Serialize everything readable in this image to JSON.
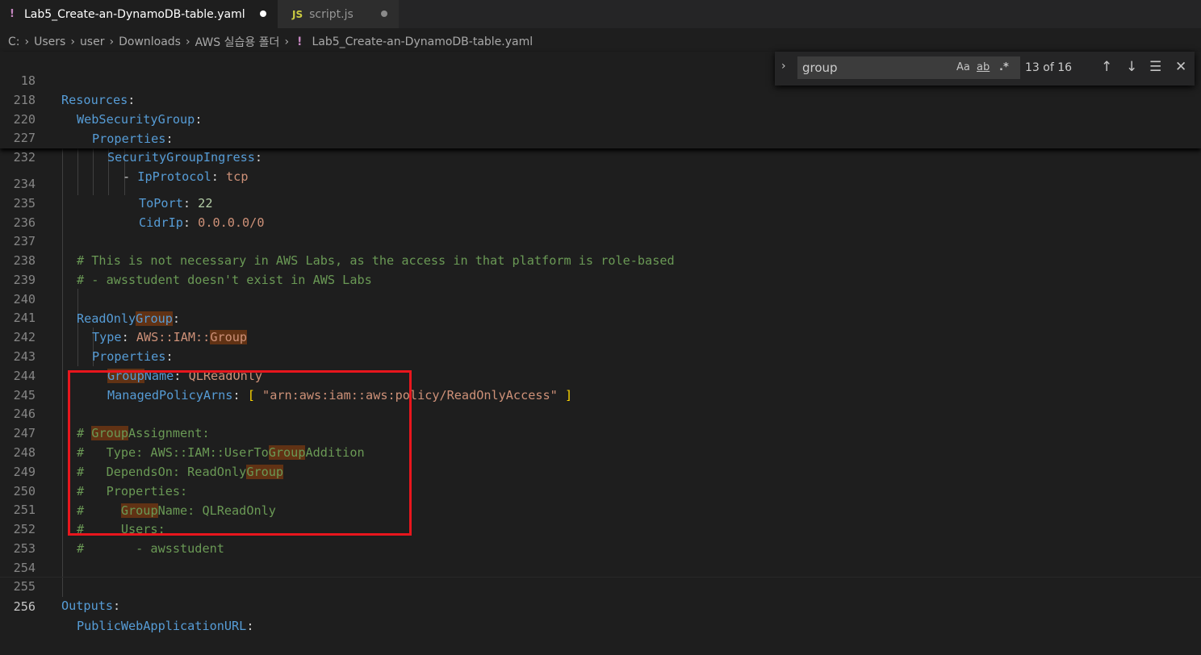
{
  "tabs": [
    {
      "label": "Lab5_Create-an-DynamoDB-table.yaml",
      "icon": "!",
      "active": true
    },
    {
      "label": "script.js",
      "icon": "JS",
      "active": false
    }
  ],
  "breadcrumb": {
    "parts": [
      "C:",
      "Users",
      "user",
      "Downloads",
      "AWS 실습용 폴더"
    ],
    "file_icon": "!",
    "file": "Lab5_Create-an-DynamoDB-table.yaml"
  },
  "find": {
    "query": "group",
    "match_case": "Aa",
    "whole_word": "ab",
    "regex": ".*",
    "count": "13 of 16"
  },
  "sticky": [
    {
      "ln": "18",
      "key": "Resources"
    },
    {
      "ln": "218",
      "key": "WebSecurityGroup"
    },
    {
      "ln": "220",
      "key": "Properties"
    },
    {
      "ln": "227",
      "key": "SecurityGroupIngress"
    },
    {
      "ln": "232",
      "dash": "- ",
      "key": "IpProtocol",
      "val": "tcp"
    }
  ],
  "lines": [
    {
      "ln": "234",
      "key": "ToPort",
      "val": "22"
    },
    {
      "ln": "235",
      "key": "CidrIp",
      "val": "0.0.0.0/0"
    },
    {
      "ln": "236"
    },
    {
      "ln": "237",
      "comment": "# This is not necessary in AWS Labs, as the access in that platform is role-based"
    },
    {
      "ln": "238",
      "comment": "# - awsstudent doesn't exist in AWS Labs"
    },
    {
      "ln": "239"
    },
    {
      "ln": "240",
      "k1": "ReadOnly",
      "k2": "Group"
    },
    {
      "ln": "241",
      "key": "Type",
      "v1": "AWS::IAM::",
      "v2": "Group"
    },
    {
      "ln": "242",
      "key": "Properties"
    },
    {
      "ln": "243",
      "k1": "Group",
      "k2": "Name",
      "val": "QLReadOnly"
    },
    {
      "ln": "244",
      "key": "ManagedPolicyArns",
      "val": "\"arn:aws:iam::aws:policy/ReadOnlyAccess\""
    },
    {
      "ln": "245"
    },
    {
      "ln": "246",
      "c1": "# ",
      "c2": "Group",
      "c3": "Assignment:"
    },
    {
      "ln": "247",
      "c1": "#   Type: AWS::IAM::UserTo",
      "c2": "Group",
      "c3": "Addition"
    },
    {
      "ln": "248",
      "c1": "#   DependsOn: ReadOnly",
      "c2": "Group",
      "c3": ""
    },
    {
      "ln": "249",
      "comment": "#   Properties:"
    },
    {
      "ln": "250",
      "c1": "#     ",
      "c2": "Group",
      "c3": "Name: QLReadOnly"
    },
    {
      "ln": "251",
      "comment": "#     Users:"
    },
    {
      "ln": "252",
      "comment": "#       - awsstudent"
    },
    {
      "ln": "253"
    },
    {
      "ln": "254"
    },
    {
      "ln": "255",
      "key": "Outputs"
    },
    {
      "ln": "256",
      "key": "PublicWebApplicationURL"
    }
  ]
}
